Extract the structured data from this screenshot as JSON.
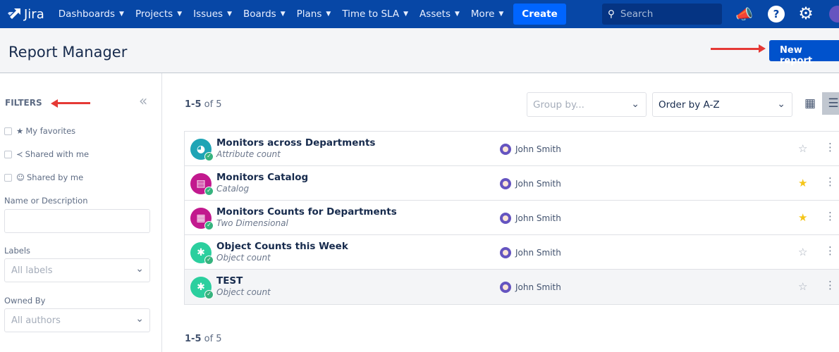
{
  "nav": {
    "brand": "Jira",
    "items": [
      "Dashboards",
      "Projects",
      "Issues",
      "Boards",
      "Plans",
      "Time to SLA",
      "Assets",
      "More"
    ],
    "create": "Create",
    "search_placeholder": "Search"
  },
  "header": {
    "title": "Report Manager",
    "new_report": "New report"
  },
  "sidebar": {
    "filters": "FILTERS",
    "my_favorites": "My favorites",
    "shared_with_me": "Shared with me",
    "shared_by_me": "Shared by me",
    "name_label": "Name or Description",
    "name_value": "",
    "labels_label": "Labels",
    "labels_placeholder": "All labels",
    "owned_label": "Owned By",
    "owned_placeholder": "All authors"
  },
  "main": {
    "range": "1-5",
    "of": "of 5",
    "group_by": "Group by...",
    "order_by": "Order by A-Z"
  },
  "reports": [
    {
      "name": "Monitors across Departments",
      "type": "Attribute count",
      "owner": "John Smith",
      "favorite": false,
      "color": "#1fa4b5",
      "icon": "pie-chart"
    },
    {
      "name": "Monitors Catalog",
      "type": "Catalog",
      "owner": "John Smith",
      "favorite": true,
      "color": "#c2198e",
      "icon": "catalog"
    },
    {
      "name": "Monitors Counts for Departments",
      "type": "Two Dimensional",
      "owner": "John Smith",
      "favorite": true,
      "color": "#c2198e",
      "icon": "table"
    },
    {
      "name": "Object Counts this Week",
      "type": "Object count",
      "owner": "John Smith",
      "favorite": false,
      "color": "#2bcf9e",
      "icon": "object-count"
    },
    {
      "name": "TEST",
      "type": "Object count",
      "owner": "John Smith",
      "favorite": false,
      "color": "#2bcf9e",
      "icon": "object-count"
    }
  ]
}
